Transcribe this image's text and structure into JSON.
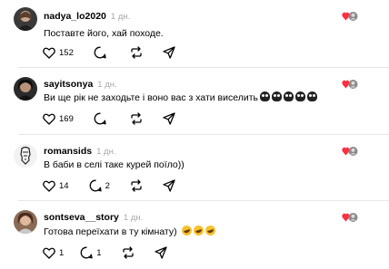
{
  "comments": [
    {
      "username": "nadya_lo2020",
      "time": "1 дн.",
      "text": "Поставте його, хай походе.",
      "likes": "152",
      "replies": "",
      "reaction_icon": "heart-with-avatar-icon",
      "avatar_color": "#3a3a3a",
      "emoji": []
    },
    {
      "username": "sayitsonya",
      "time": "1 дн.",
      "text": "Ви ще рік не заходьте і воно вас з хати виселить",
      "likes": "169",
      "replies": "",
      "reaction_icon": "heart-with-avatar-icon",
      "avatar_color": "#2b2b2b",
      "emoji": [
        "skull-emoji",
        "skull-emoji",
        "skull-emoji",
        "skull-emoji",
        "skull-emoji"
      ]
    },
    {
      "username": "romansids",
      "time": "1 дн.",
      "text": "В баби в селі таке курей поїло))",
      "likes": "14",
      "replies": "2",
      "reaction_icon": "heart-with-avatar-icon",
      "avatar_color": "#f2f2f2",
      "emoji": []
    },
    {
      "username": "sontseva__story",
      "time": "1 дн.",
      "text": "Готова переїхати в ту кімнату)",
      "likes": "1",
      "replies": "1",
      "reaction_icon": "heart-with-avatar-icon",
      "avatar_color": "#8b6b55",
      "emoji": [
        "rolling-laughing-emoji",
        "rolling-laughing-emoji",
        "rolling-laughing-emoji"
      ]
    }
  ],
  "colors": {
    "heart_red": "#ff3040",
    "muted_text": "#a8a8a8",
    "divider": "#e6e6e6"
  }
}
